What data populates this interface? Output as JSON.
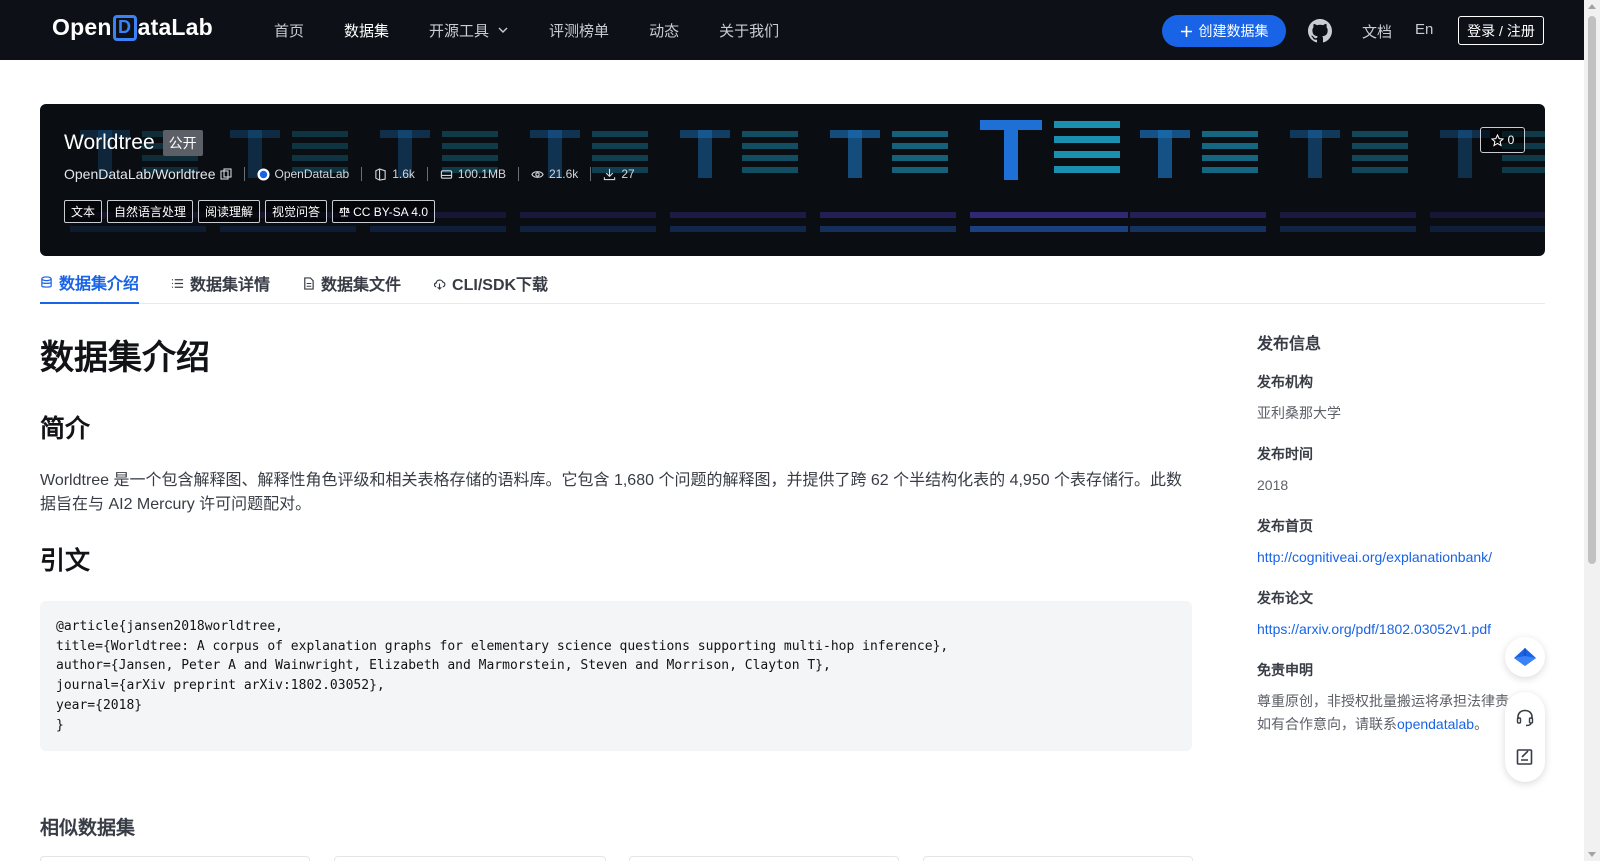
{
  "nav": {
    "logo_pre": "Open",
    "logo_d": "D",
    "logo_post": "ataLab",
    "items": [
      "首页",
      "数据集",
      "开源工具",
      "评测榜单",
      "动态",
      "关于我们"
    ],
    "create_label": "创建数据集",
    "docs_label": "文档",
    "lang_label": "En",
    "login_label": "登录 / 注册"
  },
  "dataset": {
    "name": "Worldtree",
    "visibility": "公开",
    "repo": "OpenDataLab/Worldtree",
    "publisher": "OpenDataLab",
    "files": "1.6k",
    "size": "100.1MB",
    "views": "21.6k",
    "downloads": "27",
    "tags": [
      "文本",
      "自然语言处理",
      "阅读理解",
      "视觉问答"
    ],
    "license": "CC BY-SA 4.0",
    "stars": "0"
  },
  "tabs": [
    "数据集介绍",
    "数据集详情",
    "数据集文件",
    "CLI/SDK下载"
  ],
  "content": {
    "h1": "数据集介绍",
    "intro_heading": "简介",
    "intro_text": "Worldtree 是一个包含解释图、解释性角色评级和相关表格存储的语料库。它包含 1,680 个问题的解释图，并提供了跨 62 个半结构化表的 4,950 个表存储行。此数据旨在与 AI2 Mercury 许可问题配对。",
    "citation_heading": "引文",
    "citation": "@article{jansen2018worldtree,\ntitle={Worldtree: A corpus of explanation graphs for elementary science questions supporting multi-hop inference},\nauthor={Jansen, Peter A and Wainwright, Elizabeth and Marmorstein, Steven and Morrison, Clayton T},\njournal={arXiv preprint arXiv:1802.03052},\nyear={2018}\n}",
    "similar_heading": "相似数据集"
  },
  "sidebar": {
    "heading": "发布信息",
    "org_label": "发布机构",
    "org_value": "亚利桑那大学",
    "time_label": "发布时间",
    "time_value": "2018",
    "homepage_label": "发布首页",
    "homepage_value": "http://cognitiveai.org/explanationbank/",
    "paper_label": "发布论文",
    "paper_value": "https://arxiv.org/pdf/1802.03052v1.pdf",
    "disclaimer_label": "免责申明",
    "disclaimer_line1": "尊重原创，非授权批量搬运将承担法律责",
    "disclaimer_line2_pre": "如有合作意向，请联系",
    "disclaimer_link": "opendatalab",
    "disclaimer_line2_post": "。"
  },
  "colors": {
    "nav_bg": "#0d1117",
    "accent": "#1964e6",
    "banner_bg": "#0a0d12"
  }
}
